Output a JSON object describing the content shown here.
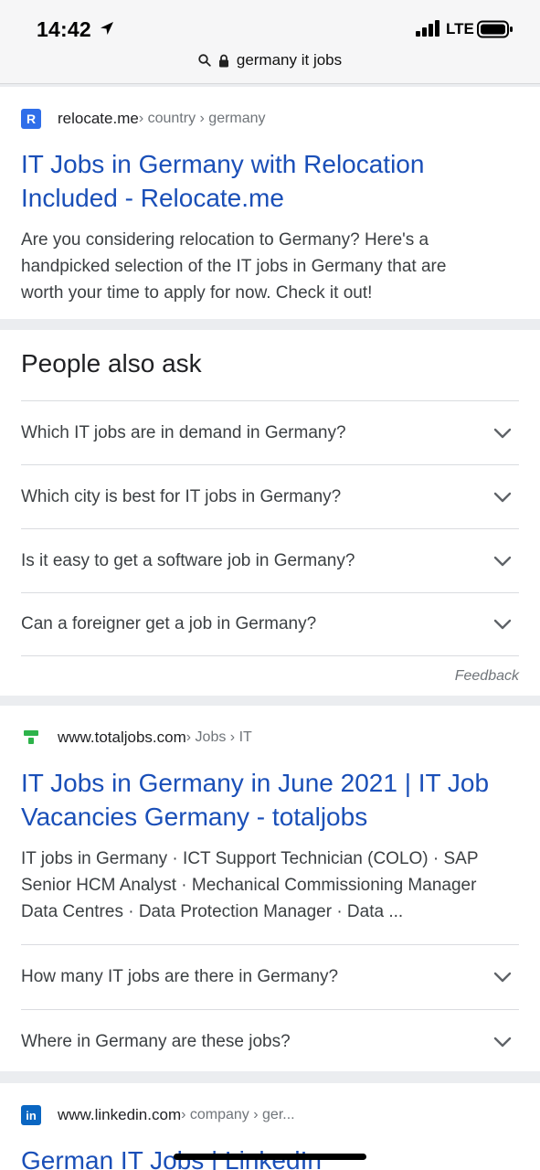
{
  "status": {
    "time": "14:42",
    "network": "LTE"
  },
  "url_bar": {
    "text": "germany it jobs"
  },
  "results": [
    {
      "favicon_letter": "R",
      "favicon_color": "#2f6ee9",
      "domain": "relocate.me",
      "breadcrumb": " › country › germany",
      "title_line1": "IT Jobs in Germany with Relocation",
      "title_line2": "Included - Relocate.me",
      "snippet_lines": [
        "Are you considering relocation to Germany? Here's a",
        "handpicked selection of the IT jobs in Germany that are",
        "worth your time to apply for now. Check it out!"
      ]
    },
    {
      "favicon_color": "#2db34a",
      "domain": "www.totaljobs.com",
      "breadcrumb": " › Jobs › IT",
      "title_line1": "IT Jobs in Germany in June 2021 | IT Job",
      "title_line2": "Vacancies Germany - totaljobs",
      "snippet_lines": [
        "IT jobs in Germany · ICT Support Technician (COLO) · SAP",
        "Senior HCM Analyst · Mechanical Commissioning Manager",
        "Data Centres · Data Protection Manager · Data ..."
      ],
      "questions": [
        "How many IT jobs are there in Germany?",
        "Where in Germany are these jobs?"
      ]
    },
    {
      "favicon_letter": "in",
      "favicon_color": "#0a66c2",
      "domain": "www.linkedin.com",
      "breadcrumb": " › company › ger...",
      "title_line1": "German IT Jobs | LinkedIn"
    }
  ],
  "people_also_ask": {
    "heading": "People also ask",
    "questions": [
      "Which IT jobs are in demand in Germany?",
      "Which city is best for IT jobs in Germany?",
      "Is it easy to get a software job in Germany?",
      "Can a foreigner get a job in Germany?"
    ],
    "feedback_label": "Feedback"
  }
}
